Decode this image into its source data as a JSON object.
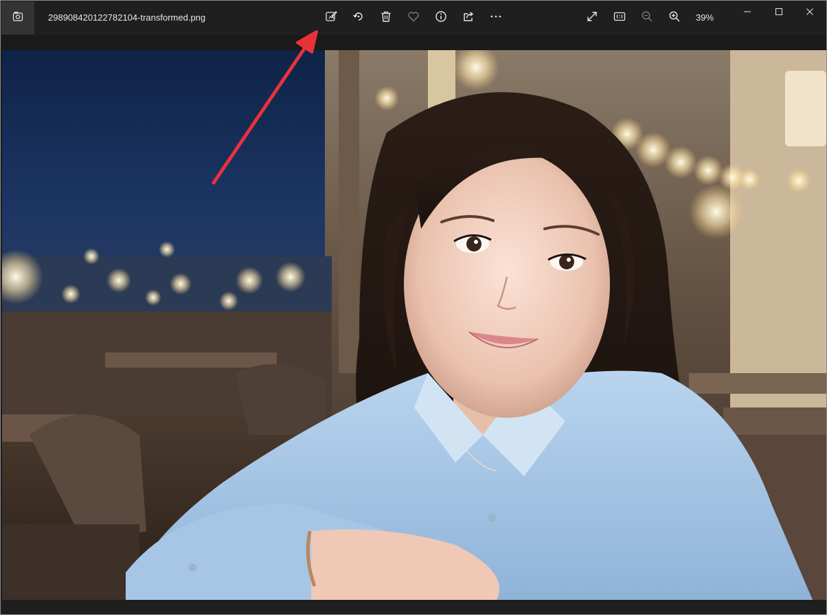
{
  "window": {
    "filename": "298908420122782104-transformed.png",
    "zoom_level": "39%"
  },
  "toolbar": {
    "tools": [
      {
        "name": "edit-image-icon"
      },
      {
        "name": "rotate-icon"
      },
      {
        "name": "delete-icon"
      },
      {
        "name": "favorite-heart-icon"
      },
      {
        "name": "info-icon"
      },
      {
        "name": "share-icon"
      },
      {
        "name": "more-options-icon"
      }
    ],
    "right_tools": [
      {
        "name": "fullscreen-icon"
      },
      {
        "name": "actual-size-icon"
      },
      {
        "name": "zoom-out-icon"
      },
      {
        "name": "zoom-in-icon"
      }
    ]
  },
  "window_controls": [
    "minimize-icon",
    "maximize-icon",
    "close-icon"
  ],
  "photo": {
    "subject": "portrait-photo"
  },
  "colors": {
    "titlebar_bg": "#1f1f1f",
    "icon_fg": "#e8e8e8",
    "annotation_arrow": "#e8323a"
  }
}
